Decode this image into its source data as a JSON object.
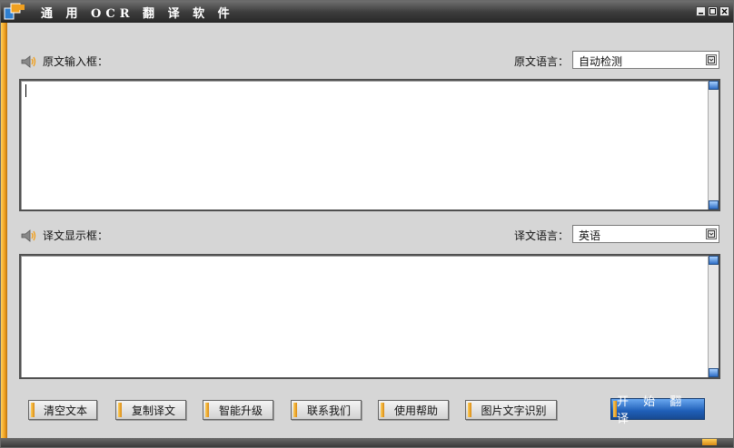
{
  "window": {
    "title": "通 用 OCR 翻 译 软 件"
  },
  "source": {
    "label": "原文输入框：",
    "lang_label": "原文语言：",
    "lang_value": "自动检测",
    "text": ""
  },
  "target": {
    "label": "译文显示框：",
    "lang_label": "译文语言：",
    "lang_value": "英语",
    "text": ""
  },
  "buttons": {
    "clear": "清空文本",
    "copy": "复制译文",
    "upgrade": "智能升级",
    "contact": "联系我们",
    "help": "使用帮助",
    "ocr": "图片文字识别",
    "start": "开 始 翻 译"
  },
  "colors": {
    "accent_orange": "#f0a020",
    "accent_blue": "#2f6fc6",
    "titlebar": "#3c3c3c"
  }
}
